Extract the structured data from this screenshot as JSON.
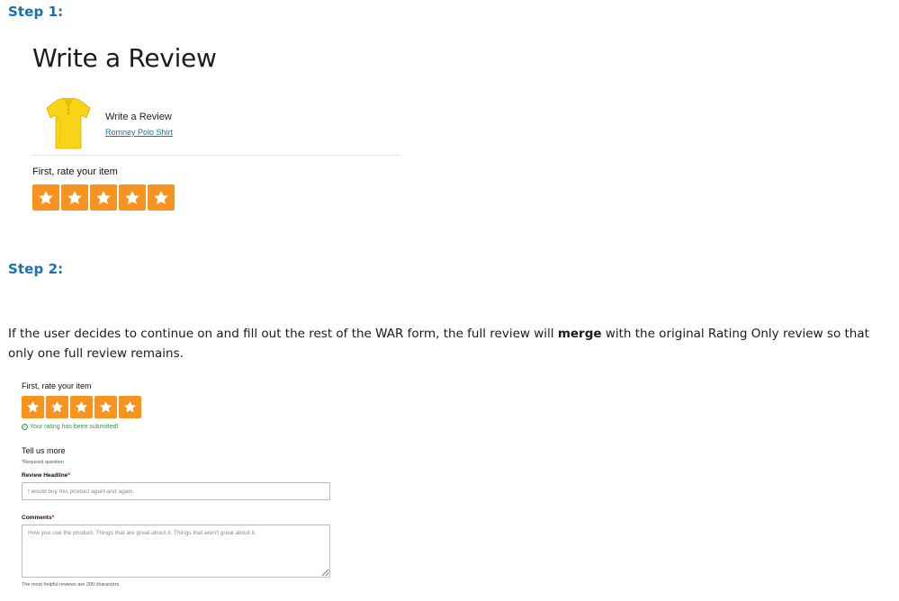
{
  "steps": {
    "step1_label": "Step 1:",
    "step2_label": "Step 2:"
  },
  "war_form": {
    "title": "Write a Review",
    "product": {
      "heading": "Write a Review",
      "link_text": "Romney Polo Shirt",
      "image_icon": "yellow-polo-shirt",
      "shirt_color": "#f7d417"
    },
    "rate_label": "First, rate your item",
    "rating": {
      "value": 5,
      "max": 5
    }
  },
  "explanation": {
    "before": "If the user decides to continue on and fill out the rest of the WAR form, the full review will ",
    "emphasis": "merge",
    "after": " with the original Rating Only review so that only one full review remains."
  },
  "full_form": {
    "rate_label": "First, rate your item",
    "rating": {
      "value": 5,
      "max": 5
    },
    "confirmation": "Your rating has been submitted!",
    "section_title": "Tell us more",
    "required_note": "Required question",
    "headline": {
      "label": "Review Headline",
      "placeholder": "I would buy this product again and again."
    },
    "comments": {
      "label": "Comments",
      "placeholder": "How you use the product. Things that are great about it. Things that aren't great about it."
    },
    "helper": "The most helpful reviews are 200 characters."
  },
  "colors": {
    "step_heading": "#1a6fb0",
    "star_bg": "#f7931e",
    "success": "#2e9e4b",
    "required": "#d0021b",
    "link": "#1a6fb0"
  }
}
